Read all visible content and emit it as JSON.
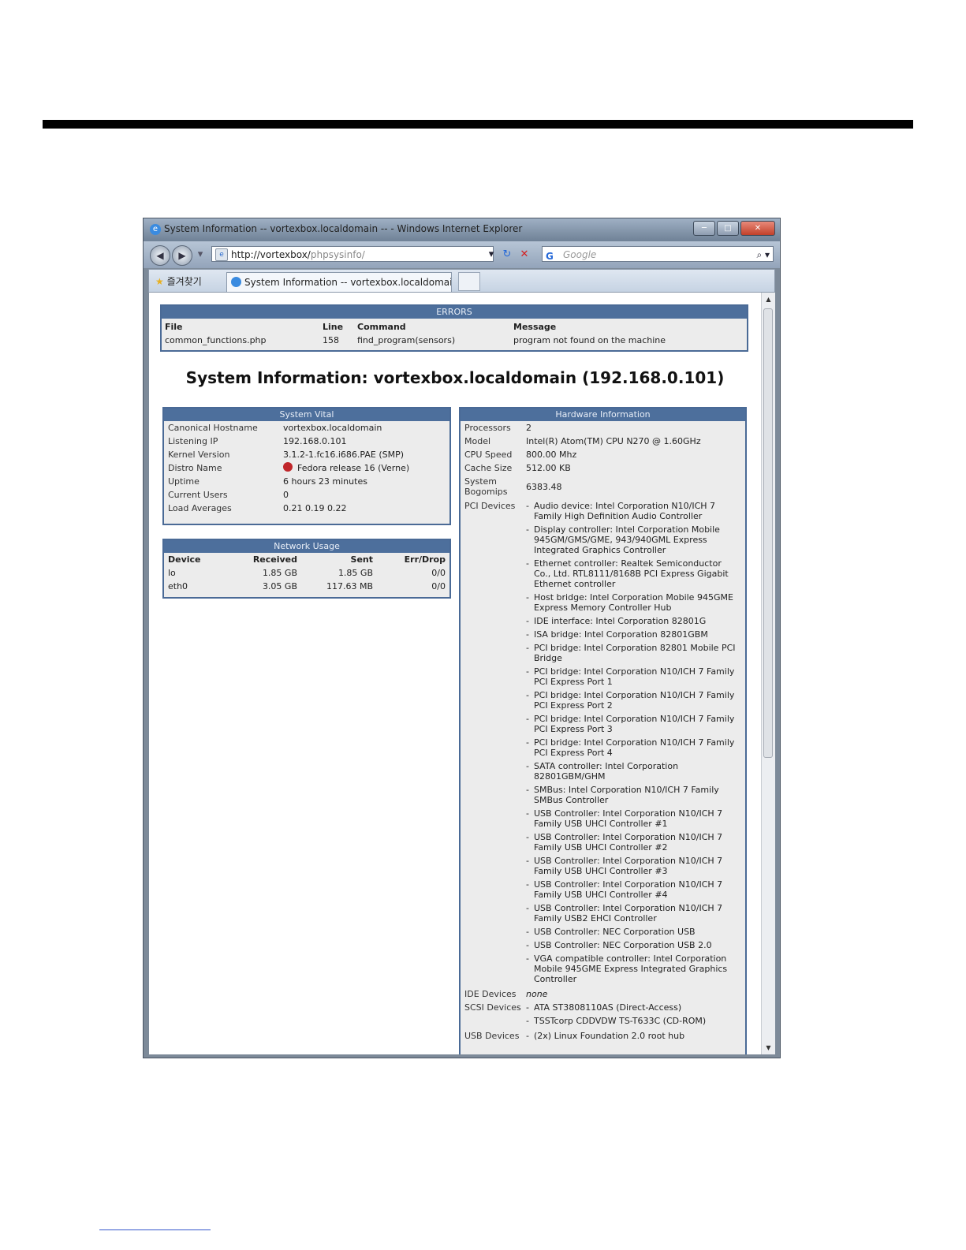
{
  "window": {
    "title": "System Information -- vortexbox.localdomain -- - Windows Internet Explorer",
    "address_host": "http://vortexbox/",
    "address_path": "phpsysinfo/",
    "search_placeholder": "Google",
    "favorites_label": "즐겨찾기",
    "tab_label": "System Information -- vortexbox.localdomain --"
  },
  "errors": {
    "heading": "ERRORS",
    "columns": [
      "File",
      "Line",
      "Command",
      "Message"
    ],
    "rows": [
      [
        "common_functions.php",
        "158",
        "find_program(sensors)",
        "program not found on the machine"
      ]
    ]
  },
  "page_title": "System Information: vortexbox.localdomain (192.168.0.101)",
  "vital": {
    "heading": "System Vital",
    "rows": [
      [
        "Canonical Hostname",
        "vortexbox.localdomain"
      ],
      [
        "Listening IP",
        "192.168.0.101"
      ],
      [
        "Kernel Version",
        "3.1.2-1.fc16.i686.PAE (SMP)"
      ],
      [
        "Distro Name",
        "Fedora release 16 (Verne)"
      ],
      [
        "Uptime",
        "6 hours 23 minutes"
      ],
      [
        "Current Users",
        "0"
      ],
      [
        "Load Averages",
        "0.21 0.19 0.22"
      ]
    ]
  },
  "network": {
    "heading": "Network Usage",
    "columns": [
      "Device",
      "Received",
      "Sent",
      "Err/Drop"
    ],
    "rows": [
      [
        "lo",
        "1.85 GB",
        "1.85 GB",
        "0/0"
      ],
      [
        "eth0",
        "3.05 GB",
        "117.63 MB",
        "0/0"
      ]
    ]
  },
  "hardware": {
    "heading": "Hardware Information",
    "rows": [
      [
        "Processors",
        "2"
      ],
      [
        "Model",
        "Intel(R) Atom(TM) CPU N270 @ 1.60GHz"
      ],
      [
        "CPU Speed",
        "800.00 Mhz"
      ],
      [
        "Cache Size",
        "512.00 KB"
      ],
      [
        "System Bogomips",
        "6383.48"
      ]
    ],
    "pci_label": "PCI Devices",
    "pci_devices": [
      "Audio device: Intel Corporation N10/ICH 7 Family High Definition Audio Controller",
      "Display controller: Intel Corporation Mobile 945GM/GMS/GME, 943/940GML Express Integrated Graphics Controller",
      "Ethernet controller: Realtek Semiconductor Co., Ltd. RTL8111/8168B PCI Express Gigabit Ethernet controller",
      "Host bridge: Intel Corporation Mobile 945GME Express Memory Controller Hub",
      "IDE interface: Intel Corporation 82801G",
      "ISA bridge: Intel Corporation 82801GBM",
      "PCI bridge: Intel Corporation 82801 Mobile PCI Bridge",
      "PCI bridge: Intel Corporation N10/ICH 7 Family PCI Express Port 1",
      "PCI bridge: Intel Corporation N10/ICH 7 Family PCI Express Port 2",
      "PCI bridge: Intel Corporation N10/ICH 7 Family PCI Express Port 3",
      "PCI bridge: Intel Corporation N10/ICH 7 Family PCI Express Port 4",
      "SATA controller: Intel Corporation 82801GBM/GHM",
      "SMBus: Intel Corporation N10/ICH 7 Family SMBus Controller",
      "USB Controller: Intel Corporation N10/ICH 7 Family USB UHCI Controller #1",
      "USB Controller: Intel Corporation N10/ICH 7 Family USB UHCI Controller #2",
      "USB Controller: Intel Corporation N10/ICH 7 Family USB UHCI Controller #3",
      "USB Controller: Intel Corporation N10/ICH 7 Family USB UHCI Controller #4",
      "USB Controller: Intel Corporation N10/ICH 7 Family USB2 EHCI Controller",
      "USB Controller: NEC Corporation USB",
      "USB Controller: NEC Corporation USB 2.0",
      "VGA compatible controller: Intel Corporation Mobile 945GME Express Integrated Graphics Controller"
    ],
    "ide_label": "IDE Devices",
    "ide_value": "none",
    "scsi_label": "SCSI Devices",
    "scsi_devices": [
      "ATA ST3808110AS (Direct-Access)",
      "TSSTcorp CDDVDW TS-T633C (CD-ROM)"
    ],
    "usb_label": "USB Devices",
    "usb_devices": [
      "(2x) Linux Foundation 2.0 root hub"
    ]
  }
}
